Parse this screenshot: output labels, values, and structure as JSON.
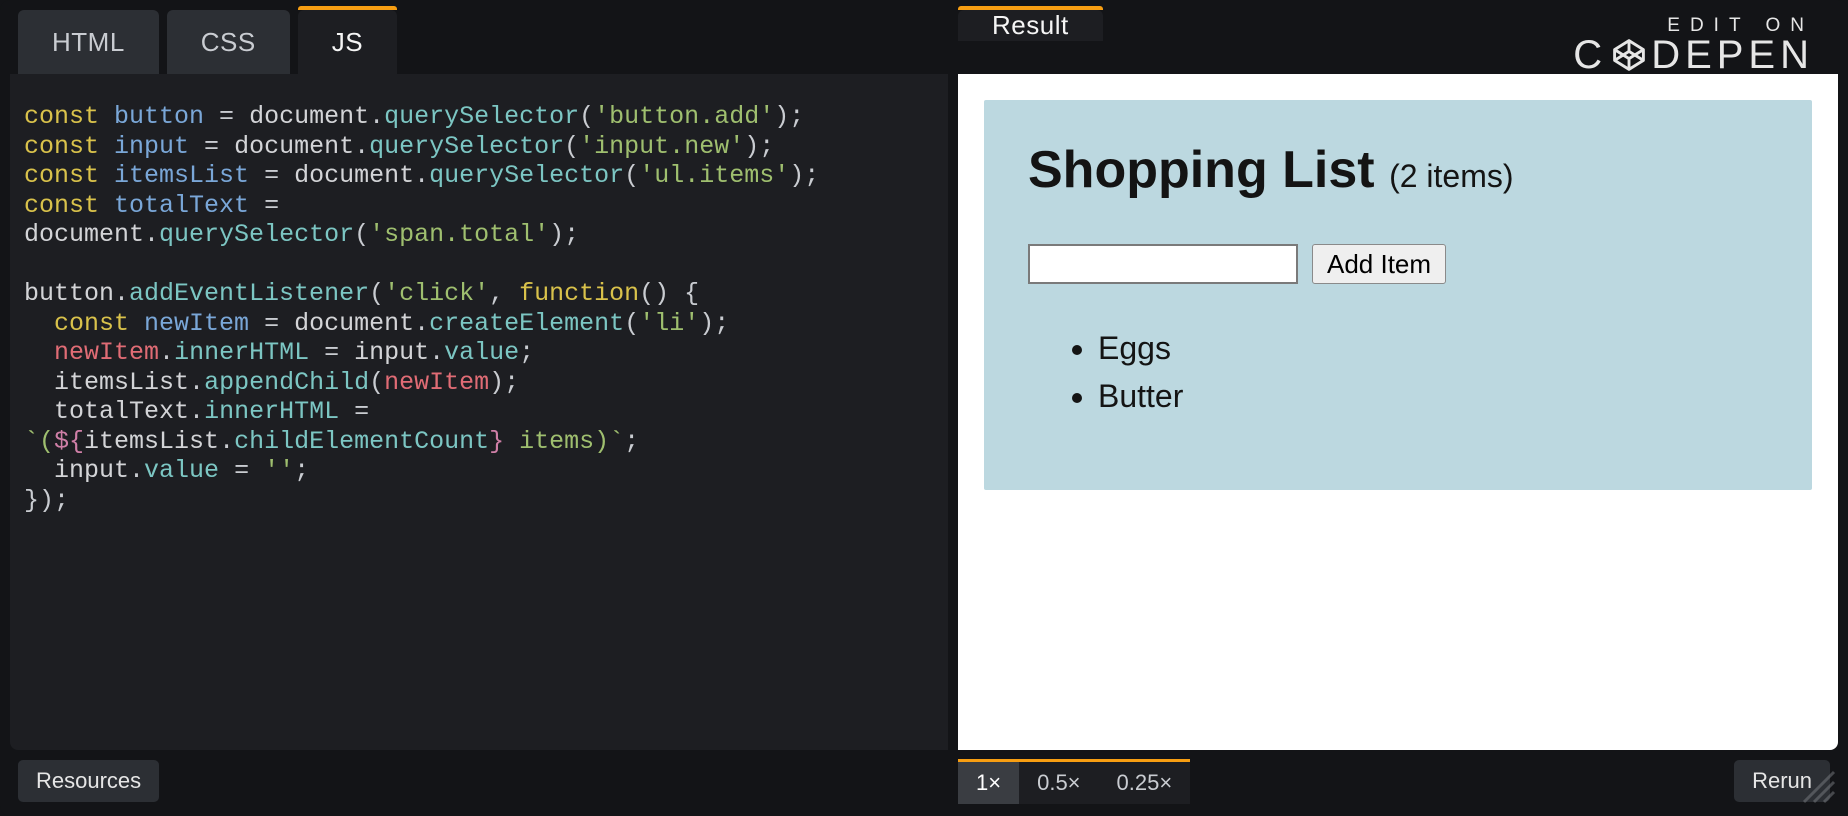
{
  "tabs": {
    "html": "HTML",
    "css": "CSS",
    "js": "JS",
    "result": "Result"
  },
  "brand": {
    "top": "EDIT ON",
    "bottom_left": "C",
    "bottom_right": "DEPEN"
  },
  "code": {
    "l1": {
      "kw": "const",
      "var": "button",
      "eq": " = ",
      "obj": "document",
      "dot": ".",
      "fn": "querySelector",
      "op": "(",
      "str": "'button.add'",
      "cp": ");"
    },
    "l2": {
      "kw": "const",
      "var": "input",
      "eq": " = ",
      "obj": "document",
      "dot": ".",
      "fn": "querySelector",
      "op": "(",
      "str": "'input.new'",
      "cp": ");"
    },
    "l3": {
      "kw": "const",
      "var": "itemsList",
      "eq": " = ",
      "obj": "document",
      "dot": ".",
      "fn": "querySelector",
      "op": "(",
      "str": "'ul.items'",
      "cp": ");"
    },
    "l4": {
      "kw": "const",
      "var": "totalText",
      "eq": " ="
    },
    "l5": {
      "obj": "document",
      "dot": ".",
      "fn": "querySelector",
      "op": "(",
      "str": "'span.total'",
      "cp": ");"
    },
    "l7a": "button",
    "l7b": ".",
    "l7c": "addEventListener",
    "l7d": "(",
    "l7e": "'click'",
    "l7f": ", ",
    "l7g": "function",
    "l7h": "() {",
    "l8": {
      "pad": "  ",
      "kw": "const",
      "var": "newItem",
      "eq": " = ",
      "obj": "document",
      "dot": ".",
      "fn": "createElement",
      "op": "(",
      "str": "'li'",
      "cp": ");"
    },
    "l9": {
      "pad": "  ",
      "obj": "newItem",
      "dot": ".",
      "prop": "innerHTML",
      "eq": " = ",
      "obj2": "input",
      "dot2": ".",
      "prop2": "value",
      "sc": ";"
    },
    "l10": {
      "pad": "  ",
      "obj": "itemsList",
      "dot": ".",
      "fn": "appendChild",
      "op": "(",
      "arg": "newItem",
      "cp": ");"
    },
    "l11": {
      "pad": "  ",
      "obj": "totalText",
      "dot": ".",
      "prop": "innerHTML",
      "eq": " ="
    },
    "l12a": "`(",
    "l12b": "${",
    "l12c": "itemsList",
    "l12d": ".",
    "l12e": "childElementCount",
    "l12f": "}",
    "l12g": " items",
    "l12h": ")`",
    "l12i": ";",
    "l13": {
      "pad": "  ",
      "obj": "input",
      "dot": ".",
      "prop": "value",
      "eq": " = ",
      "str": "''",
      "sc": ";"
    },
    "l14": "});"
  },
  "result": {
    "heading": "Shopping List ",
    "count": "(2 items)",
    "button": "Add Item",
    "input_value": "",
    "items": [
      "Eggs",
      "Butter"
    ]
  },
  "bottom": {
    "resources": "Resources",
    "zoom": [
      "1×",
      "0.5×",
      "0.25×"
    ],
    "rerun": "Rerun"
  }
}
